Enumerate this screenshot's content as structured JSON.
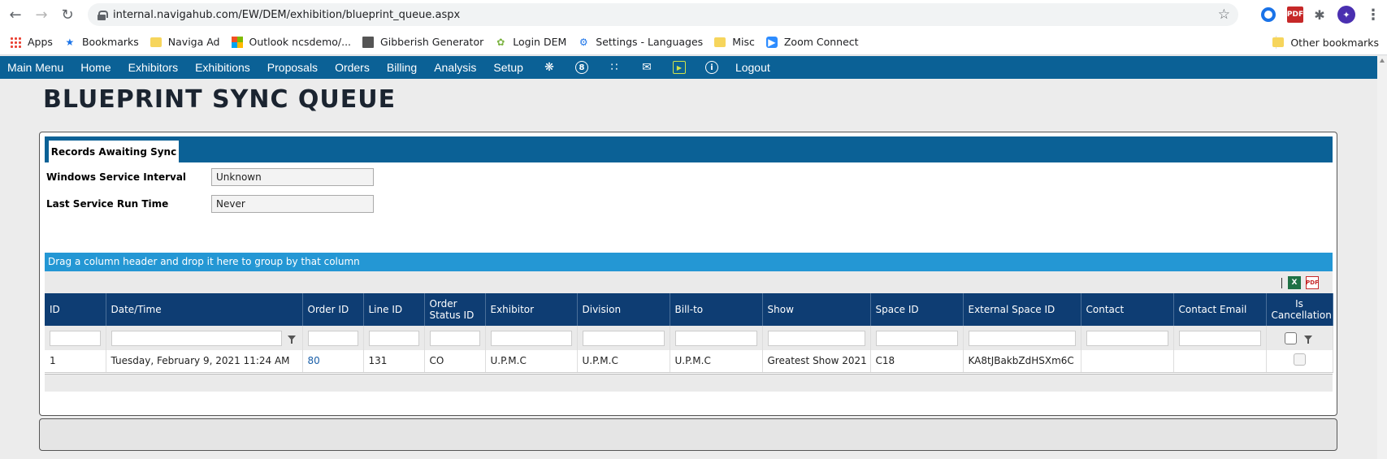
{
  "browser": {
    "url": "internal.navigahub.com/EW/DEM/exhibition/blueprint_queue.aspx",
    "bookmarks": [
      "Apps",
      "Bookmarks",
      "Naviga Ad",
      "Outlook ncsdemo/...",
      "Gibberish Generator",
      "Login DEM",
      "Settings - Languages",
      "Misc",
      "Zoom Connect"
    ],
    "other_bookmarks": "Other bookmarks"
  },
  "menu": {
    "items": [
      "Main Menu",
      "Home",
      "Exhibitors",
      "Exhibitions",
      "Proposals",
      "Orders",
      "Billing",
      "Analysis",
      "Setup"
    ],
    "badge": "8",
    "logout": "Logout"
  },
  "page": {
    "title": "BLUEPRINT SYNC QUEUE",
    "tab": "Records Awaiting Sync",
    "fields": [
      {
        "label": "Windows Service Interval",
        "value": "Unknown"
      },
      {
        "label": "Last Service Run Time",
        "value": "Never"
      }
    ],
    "group_hint": "Drag a column header and drop it here to group by that column"
  },
  "grid": {
    "columns": [
      "ID",
      "Date/Time",
      "Order ID",
      "Line ID",
      "Order Status ID",
      "Exhibitor",
      "Division",
      "Bill-to",
      "Show",
      "Space ID",
      "External Space ID",
      "Contact",
      "Contact Email",
      "Is Cancellation"
    ],
    "columns_display": {
      "status_1": "Order",
      "status_2": "Status ID",
      "cancel_1": "Is",
      "cancel_2": "Cancellation"
    },
    "rows": [
      {
        "id": "1",
        "datetime": "Tuesday, February 9, 2021 11:24 AM",
        "order_id": "80",
        "line_id": "131",
        "status": "CO",
        "exhibitor": "U.P.M.C",
        "division": "U.P.M.C",
        "bill_to": "U.P.M.C",
        "show": "Greatest Show 2021",
        "space_id": "C18",
        "external_space_id": "KA8tJBakbZdHSXm6C",
        "contact": "",
        "contact_email": "",
        "is_cancellation": false
      }
    ]
  },
  "colors": {
    "menu_bg": "#0b6196",
    "header_bg": "#0e3d73",
    "group_bar": "#2497d4",
    "link": "#1a5fa8"
  }
}
